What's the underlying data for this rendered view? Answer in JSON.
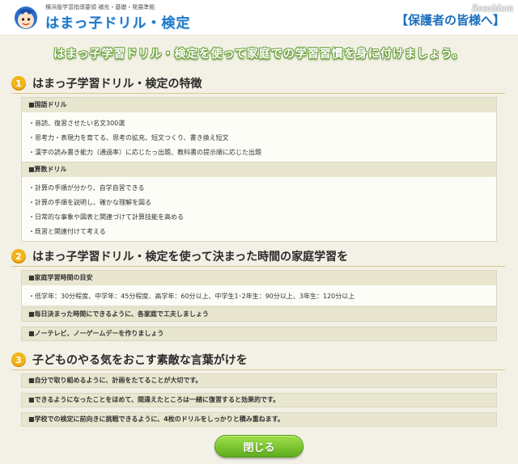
{
  "header": {
    "logo_sub": "横浜版学習指導要領 補充・基礎・発展準拠",
    "logo_title": "はまっ子ドリル・検定",
    "guardian_label": "【保護者の皆様へ】",
    "watermark": "ReseMom"
  },
  "banner": "はまっ子学習ドリル・検定を使って家庭での学習習慣を身に付けましょう。",
  "sections": [
    {
      "number": "1",
      "title": "はまっ子学習ドリル・検定の特徴",
      "panels": [
        {
          "heading": "■国語ドリル",
          "items": [
            "・音読、復習させたい名文300選",
            "・思考力・表現力を育てる、思考の拡充、短文つくり、書き換え短文",
            "・漢字の読み書き能力（通過率）に応じたっ出題、教科書の提示順に応じた出題"
          ]
        },
        {
          "heading": "■算数ドリル",
          "items": [
            "・計算の手順が分かり、自学自習できる",
            "・計算の手順を説明し、確かな理解を図る",
            "・日常的な事象や図表と関連づけて計算技能を高める",
            "・既習と関連付けて考える"
          ]
        }
      ]
    },
    {
      "number": "2",
      "title": "はまっ子学習ドリル・検定を使って決まった時間の家庭学習を",
      "panel": {
        "heading": "■家庭学習時間の目安",
        "items": [
          "・低学年：30分程度、中学年：45分程度、高学年：60分以上、中学生1･2年生：90分以上、3年生：120分以上"
        ]
      },
      "notes": [
        "■毎日決まった時間にできるように、各家庭で工夫しましょう",
        "■ノーテレビ、ノーゲームデーを作りましょう"
      ]
    },
    {
      "number": "3",
      "title": "子どものやる気をおこす素敵な言葉がけを",
      "notes": [
        "■自分で取り組めるように、計画をたてることが大切です。",
        "■できるようになったことをほめて、間違えたところは一緒に復習すると効果的です。",
        "■学校での検定に前向きに挑戦できるように、4枚のドリルをしっかりと積み重ねます。"
      ]
    }
  ],
  "close_label": "閉じる",
  "colors": {
    "accent_blue": "#1e78c8",
    "badge_orange": "#f2b51a",
    "button_green": "#5fae1e",
    "panel_head": "#e8e6cf",
    "background": "#f3f1e6"
  }
}
